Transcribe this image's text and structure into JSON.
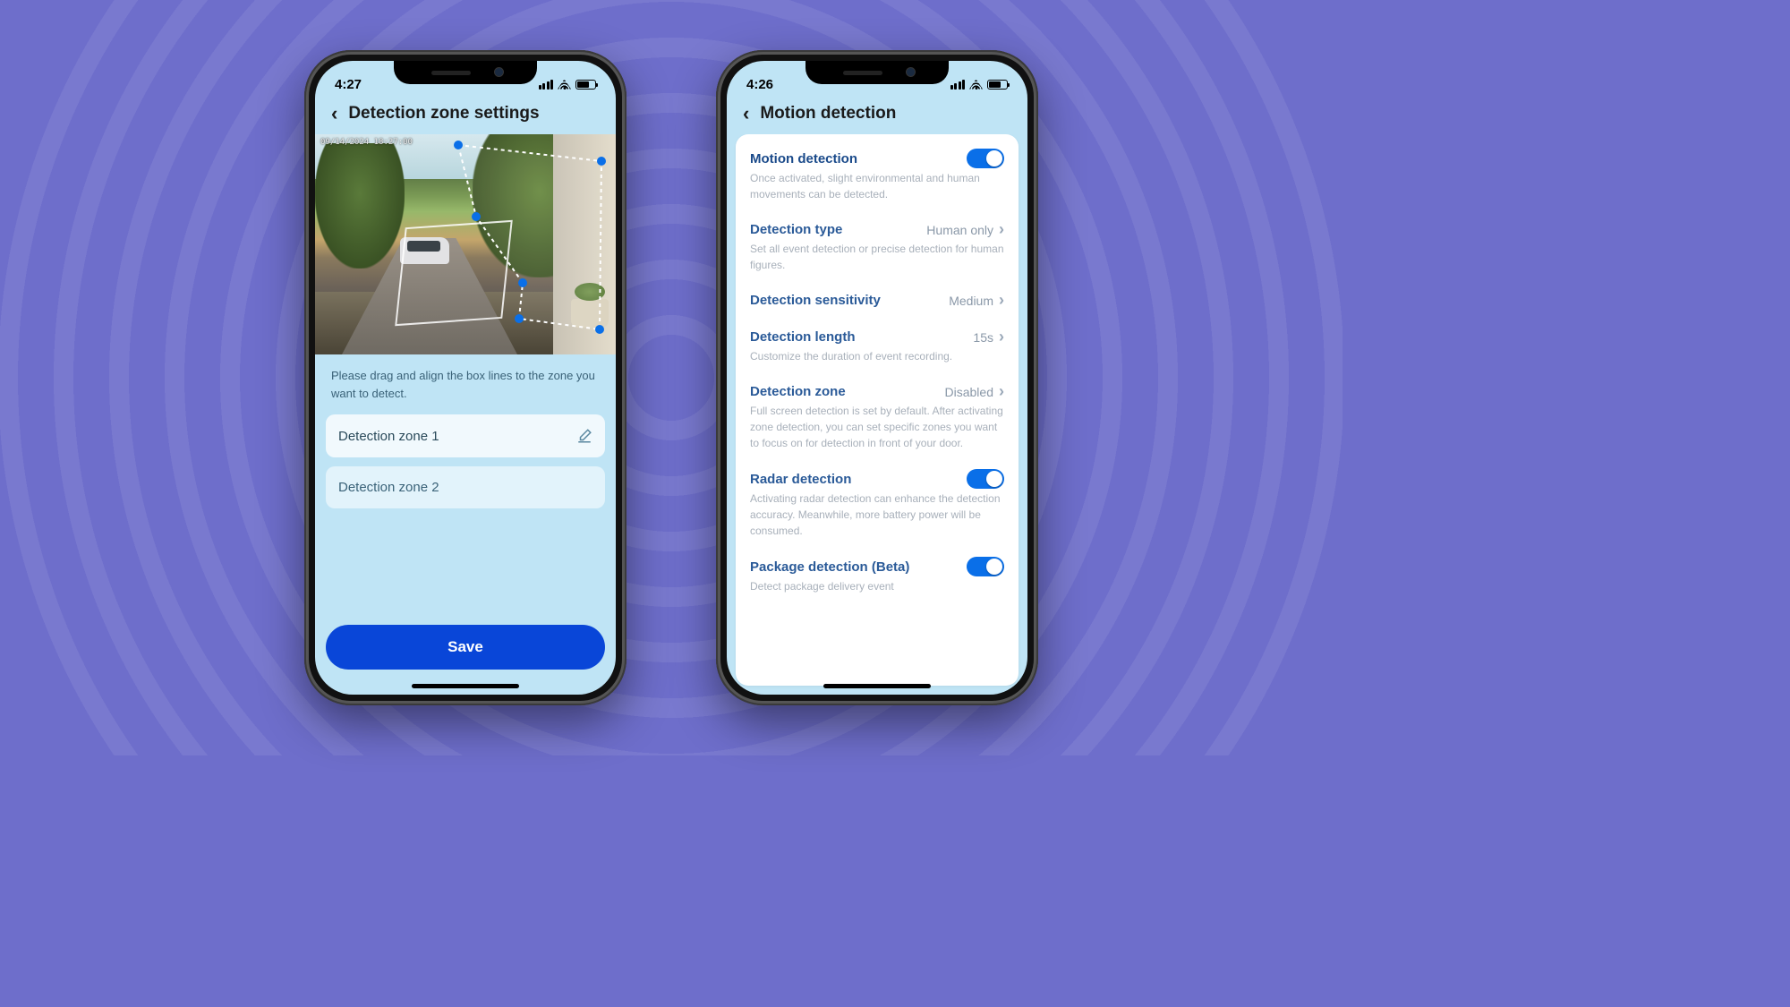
{
  "left": {
    "status_time": "4:27",
    "title": "Detection zone settings",
    "camera_timestamp": "09/14/2024 18:27:00",
    "hint": "Please drag and align the box lines to the zone you want to detect.",
    "zones": [
      {
        "label": "Detection zone 1",
        "active": true
      },
      {
        "label": "Detection zone 2",
        "active": false
      }
    ],
    "save_label": "Save"
  },
  "right": {
    "status_time": "4:26",
    "title": "Motion detection",
    "motion": {
      "label": "Motion detection",
      "enabled": true,
      "desc": "Once activated, slight environmental and human movements can be detected."
    },
    "detection_type": {
      "label": "Detection type",
      "value": "Human only",
      "desc": "Set all event detection or precise detection for human figures."
    },
    "sensitivity": {
      "label": "Detection sensitivity",
      "value": "Medium"
    },
    "length": {
      "label": "Detection length",
      "value": "15s",
      "desc": "Customize the duration of event recording."
    },
    "zone": {
      "label": "Detection zone",
      "value": "Disabled",
      "desc": "Full screen detection is set by default. After activating zone detection, you can set specific zones you want to focus on for detection in front of your door."
    },
    "radar": {
      "label": "Radar detection",
      "enabled": true,
      "desc": "Activating radar detection can enhance the detection accuracy. Meanwhile, more battery power will be consumed."
    },
    "package": {
      "label": "Package detection (Beta)",
      "enabled": true,
      "desc": "Detect package delivery event"
    }
  },
  "colors": {
    "accent": "#0a6fe8",
    "primary_button": "#0946d8",
    "heading": "#1a4a8a"
  }
}
